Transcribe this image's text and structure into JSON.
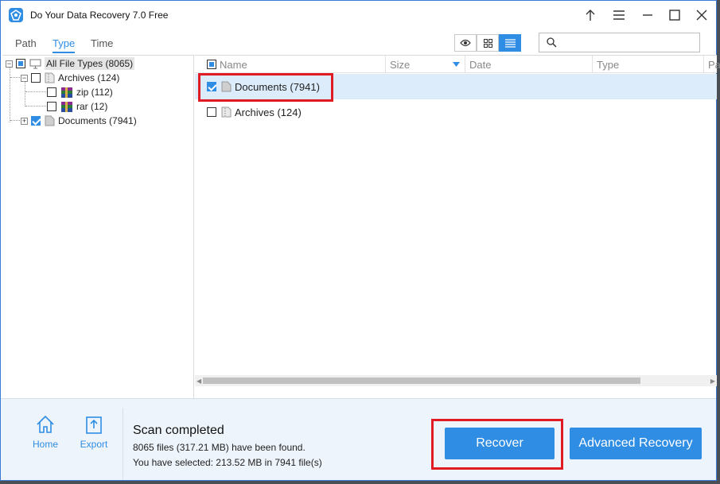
{
  "window": {
    "title": "Do Your Data Recovery 7.0 Free",
    "accent_color": "#2f8de4",
    "highlight_color": "#e01b24"
  },
  "toolbar": {
    "tabs": [
      {
        "label": "Path",
        "active": false
      },
      {
        "label": "Type",
        "active": true
      },
      {
        "label": "Time",
        "active": false
      }
    ],
    "view_modes": [
      "preview-eye-icon",
      "grid-view-icon",
      "list-view-icon"
    ],
    "active_view": "list",
    "search_placeholder": ""
  },
  "tree": {
    "root": {
      "label": "All File Types (8065)",
      "state": "partial"
    },
    "items": [
      {
        "label": "Archives (124)",
        "state": "unchecked",
        "expanded": true
      },
      {
        "label": "zip (112)",
        "state": "unchecked"
      },
      {
        "label": "rar (12)",
        "state": "unchecked"
      },
      {
        "label": "Documents (7941)",
        "state": "checked",
        "expanded": false
      }
    ]
  },
  "file_list": {
    "columns": [
      "Name",
      "Size",
      "Date",
      "Type",
      "Pa"
    ],
    "sorted_column": "Size",
    "rows": [
      {
        "name": "Documents (7941)",
        "checked": true,
        "selected": true
      },
      {
        "name": "Archives (124)",
        "checked": false,
        "selected": false
      }
    ]
  },
  "bottom": {
    "home_label": "Home",
    "export_label": "Export",
    "status_title": "Scan completed",
    "found_text": "8065 files (317.21 MB) have been found.",
    "selected_text": "You have selected: 213.52 MB in 7941 file(s)",
    "recover_label": "Recover",
    "advanced_label": "Advanced Recovery"
  }
}
